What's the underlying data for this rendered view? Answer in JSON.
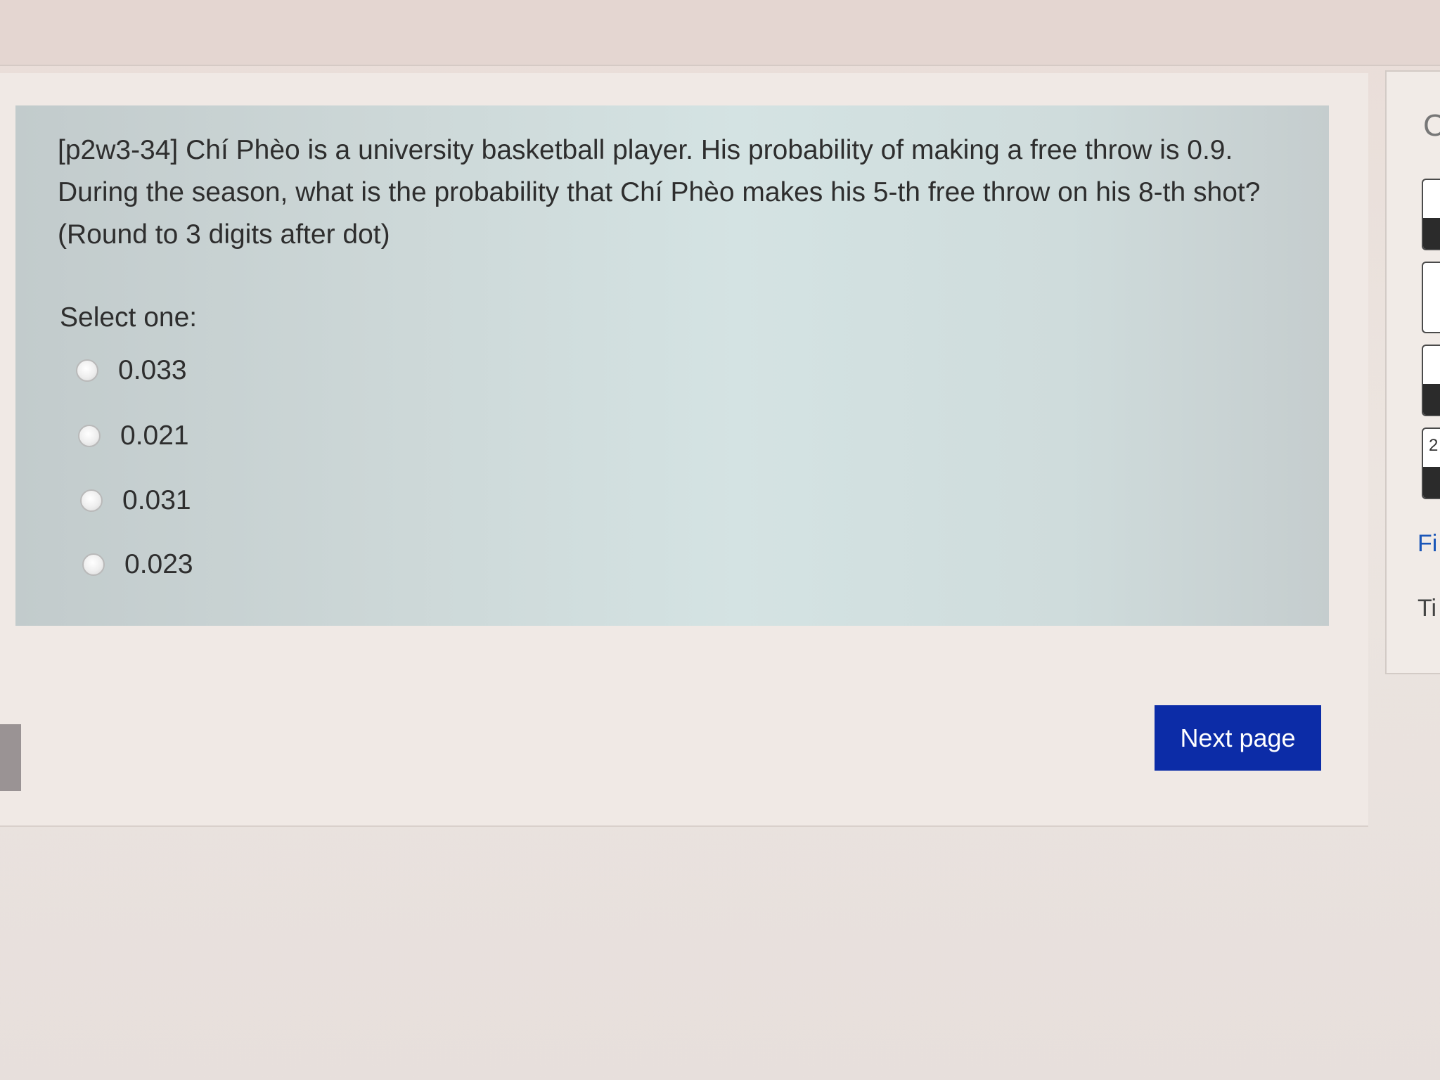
{
  "question": {
    "lines": [
      "[p2w3-34] Chí Phèo is a university basketball player. His probability of making a free throw is 0.9.",
      "During the season, what is the probability that Chí Phèo makes his 5-th free throw on his 8-th shot?",
      "(Round to 3 digits after dot)"
    ],
    "prompt": "Select one:",
    "options": [
      "0.033",
      "0.021",
      "0.031",
      "0.023"
    ]
  },
  "navigation": {
    "next_label": "Next page"
  },
  "sidebar": {
    "title_fragment": "C",
    "nav_buttons": [
      {
        "label": "",
        "state": "answered"
      },
      {
        "label": "",
        "state": "open"
      },
      {
        "label": "",
        "state": "answered"
      },
      {
        "label": "2",
        "state": "answered"
      }
    ],
    "finish_link_fragment": "Fi",
    "time_fragment": "Ti"
  },
  "colors": {
    "question_background": "#cfdcdc",
    "button_primary": "#0c2ca7",
    "page_background": "#ece5e0"
  }
}
